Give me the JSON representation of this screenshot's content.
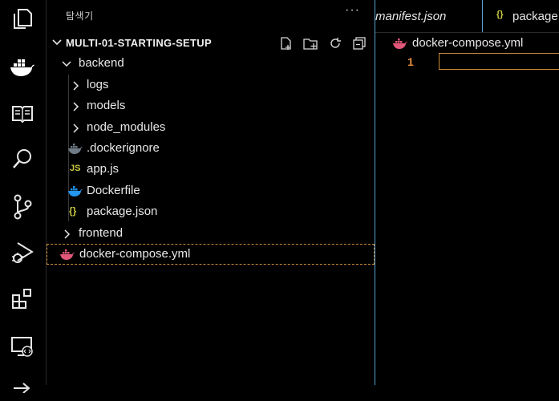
{
  "sidebar": {
    "title": "탐색기",
    "more": "···",
    "section": "MULTI-01-STARTING-SETUP",
    "items": [
      {
        "label": "backend",
        "icon": "chevron-down-icon"
      },
      {
        "label": "logs",
        "icon": "chevron-right-icon"
      },
      {
        "label": "models",
        "icon": "chevron-right-icon"
      },
      {
        "label": "node_modules",
        "icon": "chevron-right-icon"
      },
      {
        "label": ".dockerignore",
        "icon": "docker-gray-icon"
      },
      {
        "label": "app.js",
        "icon": "js-file-icon",
        "badge": "JS"
      },
      {
        "label": "Dockerfile",
        "icon": "docker-blue-icon"
      },
      {
        "label": "package.json",
        "icon": "json-braces-icon",
        "badge": "{}"
      },
      {
        "label": "frontend",
        "icon": "chevron-right-icon"
      },
      {
        "label": "docker-compose.yml",
        "icon": "docker-pink-icon"
      }
    ]
  },
  "editor": {
    "tabs": [
      {
        "label": "manifest.json"
      },
      {
        "label": "package",
        "badge": "{}"
      }
    ],
    "breadcrumb": "docker-compose.yml",
    "line_number": "1"
  },
  "colors": {
    "accent_border": "#5aa0d6",
    "active_outline": "#c98a3a",
    "line_number": "#e28b3a",
    "docker_blue": "#2496ed",
    "docker_pink": "#e0577a",
    "js_yellow": "#cbcb41"
  }
}
